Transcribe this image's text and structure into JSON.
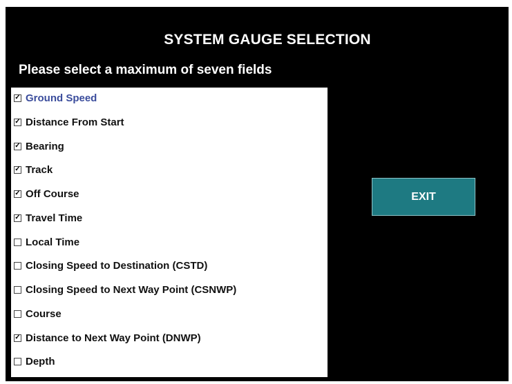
{
  "title": "SYSTEM GAUGE SELECTION",
  "subtitle": "Please select a maximum of seven fields",
  "fields": [
    {
      "label": "Ground Speed",
      "checked": true,
      "focused": true
    },
    {
      "label": "Distance From Start",
      "checked": true,
      "focused": false
    },
    {
      "label": "Bearing",
      "checked": true,
      "focused": false
    },
    {
      "label": "Track",
      "checked": true,
      "focused": false
    },
    {
      "label": "Off Course",
      "checked": true,
      "focused": false
    },
    {
      "label": "Travel Time",
      "checked": true,
      "focused": false
    },
    {
      "label": "Local Time",
      "checked": false,
      "focused": false
    },
    {
      "label": "Closing Speed to Destination (CSTD)",
      "checked": false,
      "focused": false
    },
    {
      "label": "Closing Speed to Next Way Point (CSNWP)",
      "checked": false,
      "focused": false
    },
    {
      "label": "Course",
      "checked": false,
      "focused": false
    },
    {
      "label": "Distance to Next Way Point (DNWP)",
      "checked": true,
      "focused": false
    },
    {
      "label": "Depth",
      "checked": false,
      "focused": false
    }
  ],
  "exit_label": "EXIT",
  "colors": {
    "background": "#000000",
    "exit_button": "#1e7a82",
    "focused_text": "#3a4c9c"
  }
}
